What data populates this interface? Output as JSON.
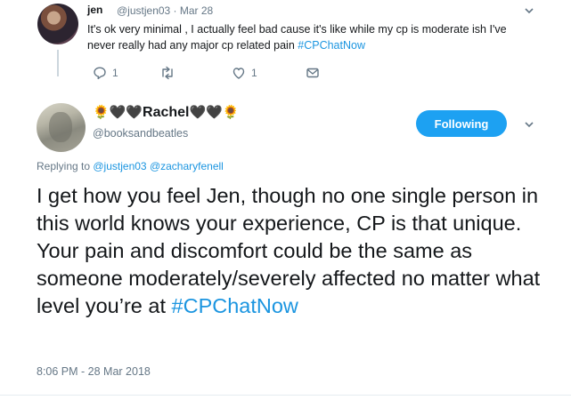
{
  "colors": {
    "accent": "#1da1f2",
    "link": "#1b95e0",
    "muted": "#657786",
    "text": "#14171a"
  },
  "reply_tweet": {
    "author_name": "jen",
    "handle_time": "@justjen03 · Mar 28",
    "text_before": "It's ok very minimal , I actually feel bad cause it's like while my cp is moderate ish I've never really had any major cp related pain ",
    "hashtag": "#CPChatNow",
    "reply_count": "1",
    "like_count": "1",
    "icons": [
      "reply-icon",
      "retweet-icon",
      "like-icon",
      "message-icon",
      "chevron-down-icon"
    ]
  },
  "main_tweet": {
    "emoji_left": "🌻🖤🖤",
    "author_name": "Rachel",
    "emoji_right": "🖤🖤🌻",
    "handle": "@booksandbeatles",
    "follow_label": "Following",
    "replying_prefix": "Replying to ",
    "mention_1": "@justjen03",
    "mention_2": "@zacharyfenell",
    "text_before": "I get how you feel Jen, though no one single person in this world knows your experience, CP is that unique. Your pain and discomfort could be the same as someone moderately/severely affected no matter what level you’re at ",
    "hashtag": "#CPChatNow",
    "timestamp": "8:06 PM - 28 Mar 2018"
  }
}
